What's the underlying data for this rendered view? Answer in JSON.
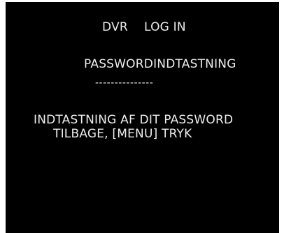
{
  "header": {
    "product": "DVR",
    "screen_title": "LOG IN"
  },
  "password": {
    "heading": "PASSWORDINDTASTNING",
    "field_value": "---------------"
  },
  "instructions": {
    "line1": "INDTASTNING AF DIT PASSWORD",
    "line2": "TILBAGE, [MENU] TRYK"
  },
  "colors": {
    "background": "#000000",
    "text": "#ececec"
  }
}
